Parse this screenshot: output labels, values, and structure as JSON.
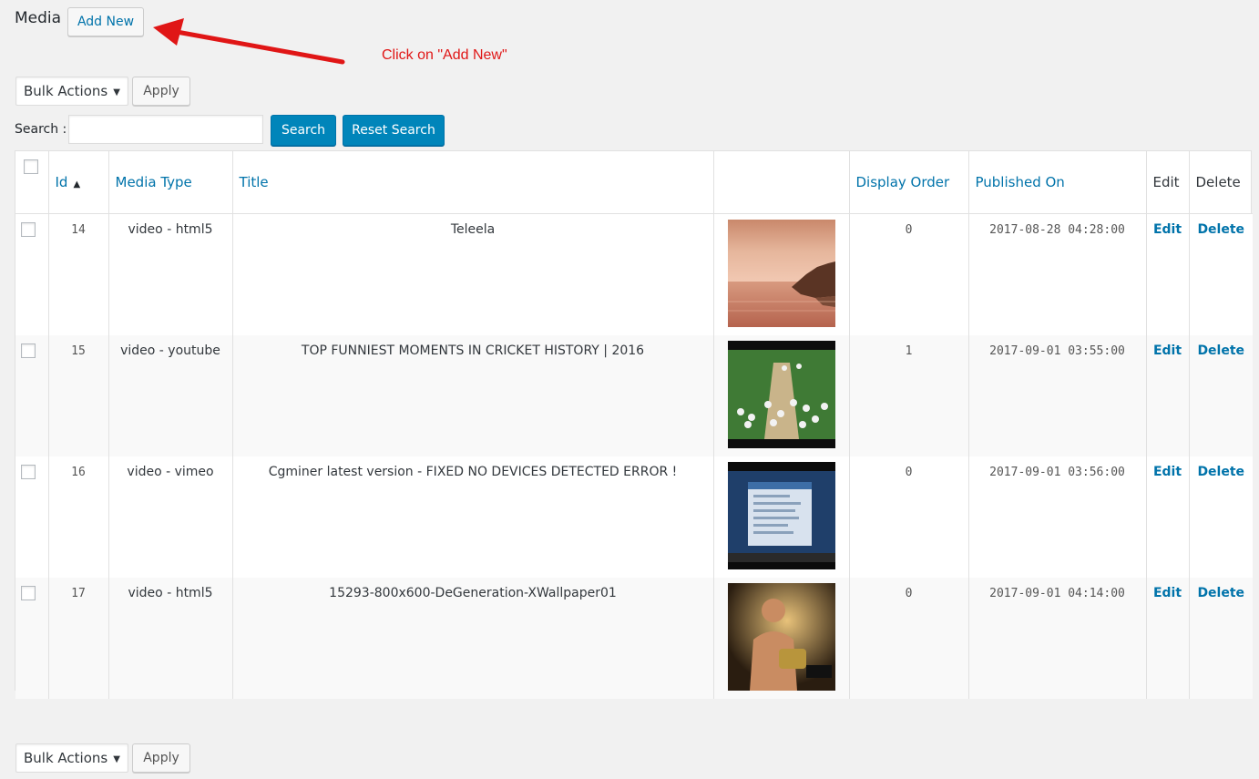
{
  "page": {
    "title": "Media",
    "add_new_label": "Add New",
    "annotation": "Click on \"Add New\""
  },
  "bulk": {
    "select_label": "Bulk Actions",
    "apply_label": "Apply"
  },
  "search": {
    "label": "Search :",
    "value": "",
    "search_button": "Search",
    "reset_button": "Reset Search"
  },
  "table": {
    "columns": {
      "id": "Id",
      "media_type": "Media Type",
      "title": "Title",
      "thumb": "",
      "display_order": "Display Order",
      "published_on": "Published On",
      "edit": "Edit",
      "delete": "Delete"
    },
    "rows": [
      {
        "id": "14",
        "media_type": "video - html5",
        "title": "Teleela",
        "display_order": "0",
        "published_on": "2017-08-28 04:28:00",
        "edit": "Edit",
        "delete": "Delete",
        "thumb_icon": "sunset-sea-thumbnail"
      },
      {
        "id": "15",
        "media_type": "video - youtube",
        "title": "TOP FUNNIEST MOMENTS IN CRICKET HISTORY | 2016",
        "display_order": "1",
        "published_on": "2017-09-01 03:55:00",
        "edit": "Edit",
        "delete": "Delete",
        "thumb_icon": "cricket-field-thumbnail"
      },
      {
        "id": "16",
        "media_type": "video - vimeo",
        "title": "Cgminer latest version - FIXED NO DEVICES DETECTED ERROR !",
        "display_order": "0",
        "published_on": "2017-09-01 03:56:00",
        "edit": "Edit",
        "delete": "Delete",
        "thumb_icon": "screen-recording-thumbnail"
      },
      {
        "id": "17",
        "media_type": "video - html5",
        "title": "15293-800x600-DeGeneration-XWallpaper01",
        "display_order": "0",
        "published_on": "2017-09-01 04:14:00",
        "edit": "Edit",
        "delete": "Delete",
        "thumb_icon": "wrestler-thumbnail"
      }
    ]
  },
  "colors": {
    "accent": "#0073aa",
    "primary_button": "#0085ba",
    "annotation": "#e01616"
  }
}
